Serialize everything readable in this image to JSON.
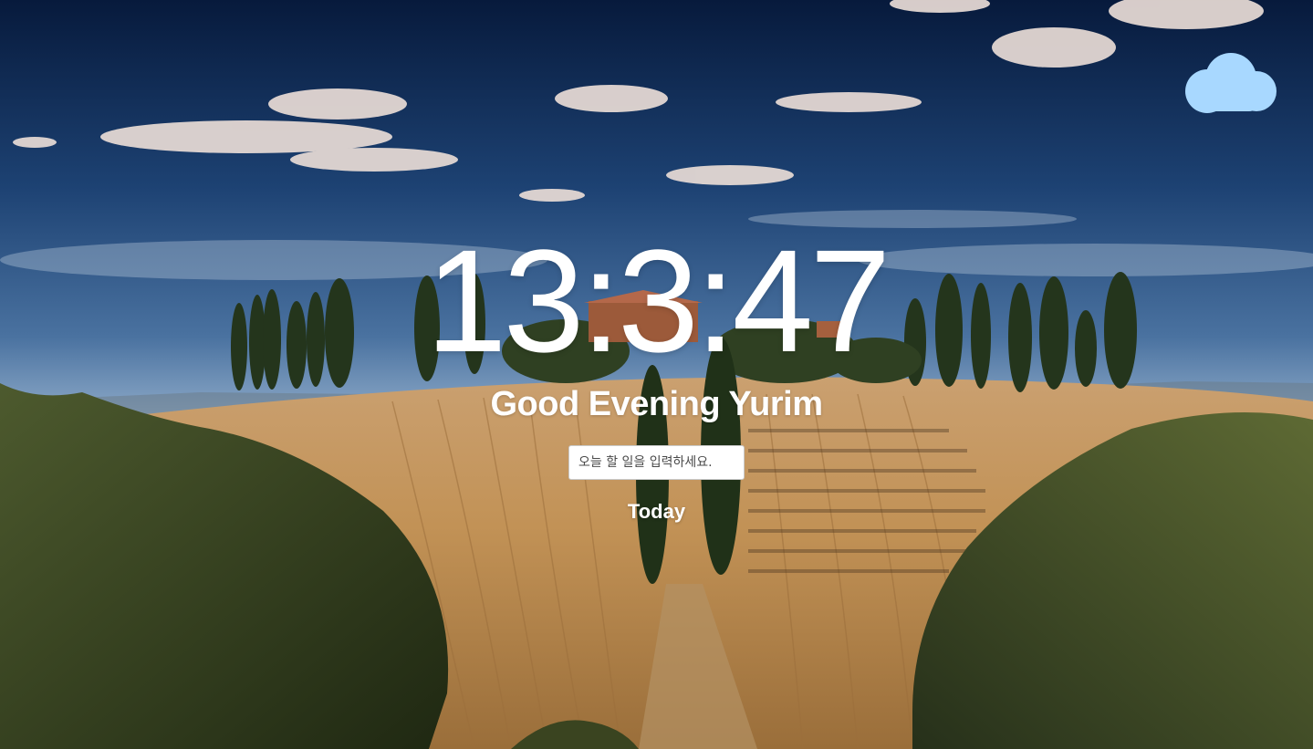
{
  "weather": {
    "icon": "cloud-icon",
    "color": "#a8d8ff"
  },
  "clock": {
    "time": "13:3:47"
  },
  "greeting": {
    "text": "Good Evening Yurim"
  },
  "todo": {
    "placeholder": "오늘 할 일을 입력하세요.",
    "value": "",
    "list_title": "Today"
  },
  "background": {
    "sky_top": "#0b2148",
    "sky_mid": "#3f6796",
    "sky_horizon": "#a9c0d8",
    "field": "#c89a5e",
    "foliage": "#3a4420"
  }
}
